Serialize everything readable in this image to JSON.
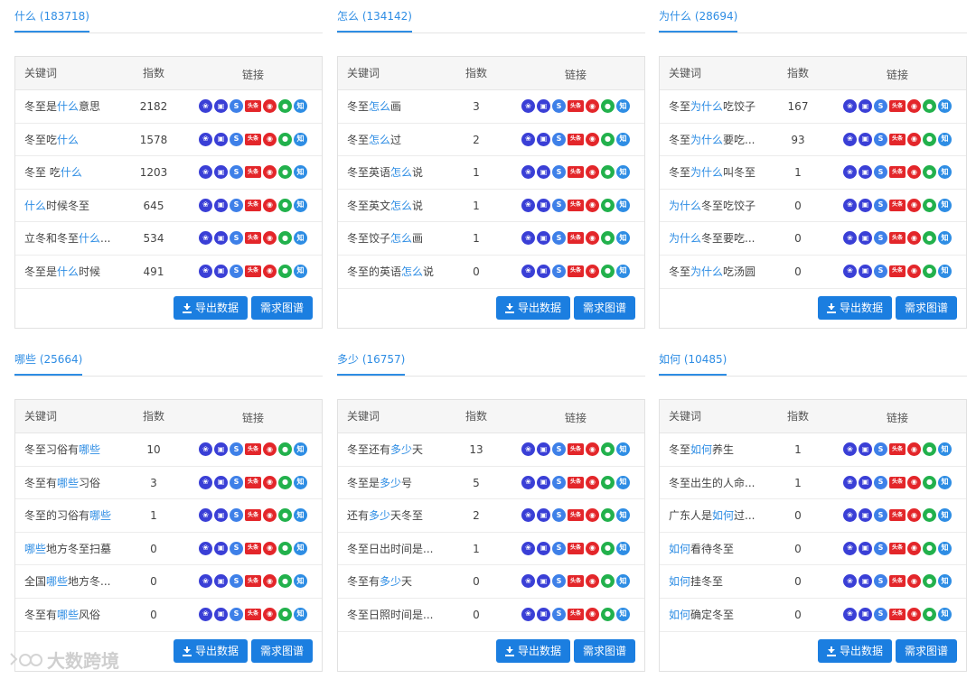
{
  "panels": [
    {
      "title": "什么 (183718)",
      "headers": {
        "keyword": "关键词",
        "index": "指数",
        "links": "链接"
      },
      "rows": [
        {
          "pre": "冬至是",
          "hl": "什么",
          "post": "意思",
          "index": "2182"
        },
        {
          "pre": "冬至吃",
          "hl": "什么",
          "post": "",
          "index": "1578"
        },
        {
          "pre": "冬至 吃",
          "hl": "什么",
          "post": "",
          "index": "1203"
        },
        {
          "pre": "",
          "hl": "什么",
          "post": "时候冬至",
          "index": "645"
        },
        {
          "pre": "立冬和冬至",
          "hl": "什么",
          "post": "...",
          "index": "534"
        },
        {
          "pre": "冬至是",
          "hl": "什么",
          "post": "时候",
          "index": "491"
        }
      ],
      "export_label": "导出数据",
      "graph_label": "需求图谱"
    },
    {
      "title": "怎么 (134142)",
      "headers": {
        "keyword": "关键词",
        "index": "指数",
        "links": "链接"
      },
      "rows": [
        {
          "pre": "冬至",
          "hl": "怎么",
          "post": "画",
          "index": "3"
        },
        {
          "pre": "冬至",
          "hl": "怎么",
          "post": "过",
          "index": "2"
        },
        {
          "pre": "冬至英语",
          "hl": "怎么",
          "post": "说",
          "index": "1"
        },
        {
          "pre": "冬至英文",
          "hl": "怎么",
          "post": "说",
          "index": "1"
        },
        {
          "pre": "冬至饺子",
          "hl": "怎么",
          "post": "画",
          "index": "1"
        },
        {
          "pre": "冬至的英语",
          "hl": "怎么",
          "post": "说",
          "index": "0"
        }
      ],
      "export_label": "导出数据",
      "graph_label": "需求图谱"
    },
    {
      "title": "为什么 (28694)",
      "headers": {
        "keyword": "关键词",
        "index": "指数",
        "links": "链接"
      },
      "rows": [
        {
          "pre": "冬至",
          "hl": "为什么",
          "post": "吃饺子",
          "index": "167"
        },
        {
          "pre": "冬至",
          "hl": "为什么",
          "post": "要吃...",
          "index": "93"
        },
        {
          "pre": "冬至",
          "hl": "为什么",
          "post": "叫冬至",
          "index": "1"
        },
        {
          "pre": "",
          "hl": "为什么",
          "post": "冬至吃饺子",
          "index": "0"
        },
        {
          "pre": "",
          "hl": "为什么",
          "post": "冬至要吃...",
          "index": "0"
        },
        {
          "pre": "冬至",
          "hl": "为什么",
          "post": "吃汤圆",
          "index": "0"
        }
      ],
      "export_label": "导出数据",
      "graph_label": "需求图谱"
    },
    {
      "title": "哪些 (25664)",
      "headers": {
        "keyword": "关键词",
        "index": "指数",
        "links": "链接"
      },
      "rows": [
        {
          "pre": "冬至习俗有",
          "hl": "哪些",
          "post": "",
          "index": "10"
        },
        {
          "pre": "冬至有",
          "hl": "哪些",
          "post": "习俗",
          "index": "3"
        },
        {
          "pre": "冬至的习俗有",
          "hl": "哪些",
          "post": "",
          "index": "1"
        },
        {
          "pre": "",
          "hl": "哪些",
          "post": "地方冬至扫墓",
          "index": "0"
        },
        {
          "pre": "全国",
          "hl": "哪些",
          "post": "地方冬...",
          "index": "0"
        },
        {
          "pre": "冬至有",
          "hl": "哪些",
          "post": "风俗",
          "index": "0"
        }
      ],
      "export_label": "导出数据",
      "graph_label": "需求图谱"
    },
    {
      "title": "多少 (16757)",
      "headers": {
        "keyword": "关键词",
        "index": "指数",
        "links": "链接"
      },
      "rows": [
        {
          "pre": "冬至还有",
          "hl": "多少",
          "post": "天",
          "index": "13"
        },
        {
          "pre": "冬至是",
          "hl": "多少",
          "post": "号",
          "index": "5"
        },
        {
          "pre": "还有",
          "hl": "多少",
          "post": "天冬至",
          "index": "2"
        },
        {
          "pre": "冬至日出时间是...",
          "hl": "",
          "post": "",
          "index": "1"
        },
        {
          "pre": "冬至有",
          "hl": "多少",
          "post": "天",
          "index": "0"
        },
        {
          "pre": "冬至日照时间是...",
          "hl": "",
          "post": "",
          "index": "0"
        }
      ],
      "export_label": "导出数据",
      "graph_label": "需求图谱"
    },
    {
      "title": "如何 (10485)",
      "headers": {
        "keyword": "关键词",
        "index": "指数",
        "links": "链接"
      },
      "rows": [
        {
          "pre": "冬至",
          "hl": "如何",
          "post": "养生",
          "index": "1"
        },
        {
          "pre": "冬至出生的人命...",
          "hl": "",
          "post": "",
          "index": "1"
        },
        {
          "pre": "广东人是",
          "hl": "如何",
          "post": "过...",
          "index": "0"
        },
        {
          "pre": "",
          "hl": "如何",
          "post": "看待冬至",
          "index": "0"
        },
        {
          "pre": "",
          "hl": "如何",
          "post": "挂冬至",
          "index": "0"
        },
        {
          "pre": "",
          "hl": "如何",
          "post": "确定冬至",
          "index": "0"
        }
      ],
      "export_label": "导出数据",
      "graph_label": "需求图谱"
    }
  ],
  "link_icons": [
    {
      "name": "baidu-icon",
      "glyph": "❀",
      "cls": "baidu"
    },
    {
      "name": "baidu-mobile-icon",
      "glyph": "▣",
      "cls": "mobile"
    },
    {
      "name": "sogou-icon",
      "glyph": "S",
      "cls": "sogou"
    },
    {
      "name": "toutiao-icon",
      "glyph": "头条",
      "cls": "toutiao"
    },
    {
      "name": "weibo-icon",
      "glyph": "◉",
      "cls": "weibo"
    },
    {
      "name": "wechat-icon",
      "glyph": "●",
      "cls": "wechat"
    },
    {
      "name": "zhihu-icon",
      "glyph": "知",
      "cls": "zhihu"
    }
  ],
  "watermark": {
    "text": "大数跨境"
  }
}
